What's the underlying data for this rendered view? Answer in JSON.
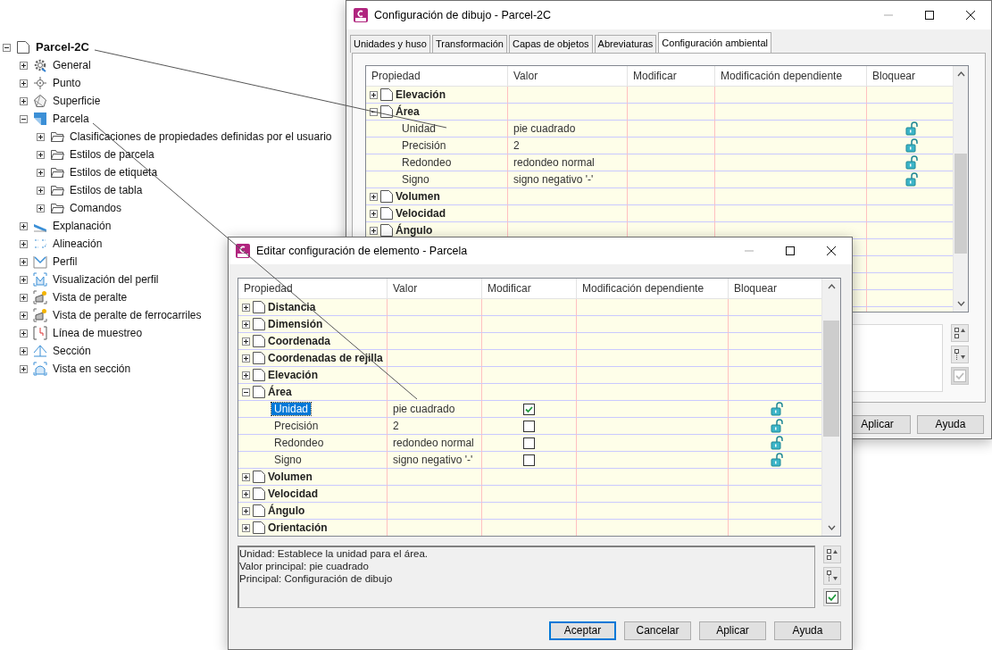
{
  "tree": {
    "label": "Parcel-2C",
    "kind": "page",
    "expanded": true,
    "children": [
      {
        "label": "General",
        "kind": "gear",
        "expanded": false
      },
      {
        "label": "Punto",
        "kind": "point",
        "expanded": false
      },
      {
        "label": "Superficie",
        "kind": "surface",
        "expanded": false
      },
      {
        "label": "Parcela",
        "kind": "parcel",
        "expanded": true,
        "children": [
          {
            "label": "Clasificaciones de propiedades definidas por el usuario",
            "kind": "folder",
            "expanded": false
          },
          {
            "label": "Estilos de parcela",
            "kind": "folder",
            "expanded": false
          },
          {
            "label": "Estilos de etiqueta",
            "kind": "folder",
            "expanded": false
          },
          {
            "label": "Estilos de tabla",
            "kind": "folder",
            "expanded": false
          },
          {
            "label": "Comandos",
            "kind": "folder",
            "expanded": false
          }
        ]
      },
      {
        "label": "Explanación",
        "kind": "grading",
        "expanded": false
      },
      {
        "label": "Alineación",
        "kind": "alignment",
        "expanded": false
      },
      {
        "label": "Perfil",
        "kind": "profile",
        "expanded": false
      },
      {
        "label": "Visualización del perfil",
        "kind": "profile-view",
        "expanded": false
      },
      {
        "label": "Vista de peralte",
        "kind": "superelevation",
        "expanded": false
      },
      {
        "label": "Vista de peralte de ferrocarriles",
        "kind": "superelevation",
        "expanded": false
      },
      {
        "label": "Línea de muestreo",
        "kind": "sample-line",
        "expanded": false
      },
      {
        "label": "Sección",
        "kind": "section",
        "expanded": false
      },
      {
        "label": "Vista en sección",
        "kind": "section-view",
        "expanded": false
      }
    ]
  },
  "drawing_settings": {
    "title": "Configuración de dibujo - Parcel-2C",
    "tabs": [
      {
        "label": "Unidades y huso",
        "selected": false
      },
      {
        "label": "Transformación",
        "selected": false
      },
      {
        "label": "Capas de objetos",
        "selected": false
      },
      {
        "label": "Abreviaturas",
        "selected": false
      },
      {
        "label": "Configuración ambiental",
        "selected": true
      }
    ],
    "columns": [
      "Propiedad",
      "Valor",
      "Modificar",
      "Modificación dependiente",
      "Bloquear"
    ],
    "rows": [
      {
        "kind": "group",
        "label": "Elevación",
        "expanded": false
      },
      {
        "kind": "group",
        "label": "Área",
        "expanded": true
      },
      {
        "kind": "property",
        "label": "Unidad",
        "value": "pie cuadrado",
        "locked": false
      },
      {
        "kind": "property",
        "label": "Precisión",
        "value": "2",
        "locked": false
      },
      {
        "kind": "property",
        "label": "Redondeo",
        "value": "redondeo normal",
        "locked": false
      },
      {
        "kind": "property",
        "label": "Signo",
        "value": "signo negativo '-'",
        "locked": false
      },
      {
        "kind": "group",
        "label": "Volumen",
        "expanded": false
      },
      {
        "kind": "group",
        "label": "Velocidad",
        "expanded": false
      },
      {
        "kind": "group",
        "label": "Ángulo",
        "expanded": false
      }
    ],
    "filter": {
      "checked": true,
      "disabled": true
    },
    "buttons": [
      {
        "label": "Aplicar",
        "default": false
      },
      {
        "label": "Ayuda",
        "default": false
      }
    ]
  },
  "element_settings": {
    "title": "Editar configuración de elemento - Parcela",
    "columns": [
      "Propiedad",
      "Valor",
      "Modificar",
      "Modificación dependiente",
      "Bloquear"
    ],
    "rows": [
      {
        "kind": "group",
        "label": "Distancia",
        "expanded": false,
        "selected": false
      },
      {
        "kind": "group",
        "label": "Dimensión",
        "expanded": false,
        "selected": false
      },
      {
        "kind": "group",
        "label": "Coordenada",
        "expanded": false,
        "selected": false
      },
      {
        "kind": "group",
        "label": "Coordenadas de rejilla",
        "expanded": false,
        "selected": false
      },
      {
        "kind": "group",
        "label": "Elevación",
        "expanded": false,
        "selected": false
      },
      {
        "kind": "group",
        "label": "Área",
        "expanded": true,
        "selected": false
      },
      {
        "kind": "property",
        "label": "Unidad",
        "value": "pie cuadrado",
        "override": true,
        "locked": false,
        "selected": true
      },
      {
        "kind": "property",
        "label": "Precisión",
        "value": "2",
        "override": false,
        "locked": false,
        "selected": false
      },
      {
        "kind": "property",
        "label": "Redondeo",
        "value": "redondeo normal",
        "override": false,
        "locked": false,
        "selected": false
      },
      {
        "kind": "property",
        "label": "Signo",
        "value": "signo negativo '-'",
        "override": false,
        "locked": false,
        "selected": false
      },
      {
        "kind": "group",
        "label": "Volumen",
        "expanded": false,
        "selected": false
      },
      {
        "kind": "group",
        "label": "Velocidad",
        "expanded": false,
        "selected": false
      },
      {
        "kind": "group",
        "label": "Ángulo",
        "expanded": false,
        "selected": false
      },
      {
        "kind": "group",
        "label": "Orientación",
        "expanded": false,
        "selected": false
      }
    ],
    "description": [
      "Unidad: Establece la unidad para el área.",
      "Valor principal: pie cuadrado",
      "Principal: Configuración de dibujo"
    ],
    "filter": {
      "checked": true,
      "disabled": false
    },
    "buttons": [
      {
        "label": "Aceptar",
        "default": true
      },
      {
        "label": "Cancelar",
        "default": false
      },
      {
        "label": "Aplicar",
        "default": false
      },
      {
        "label": "Ayuda",
        "default": false
      }
    ]
  }
}
